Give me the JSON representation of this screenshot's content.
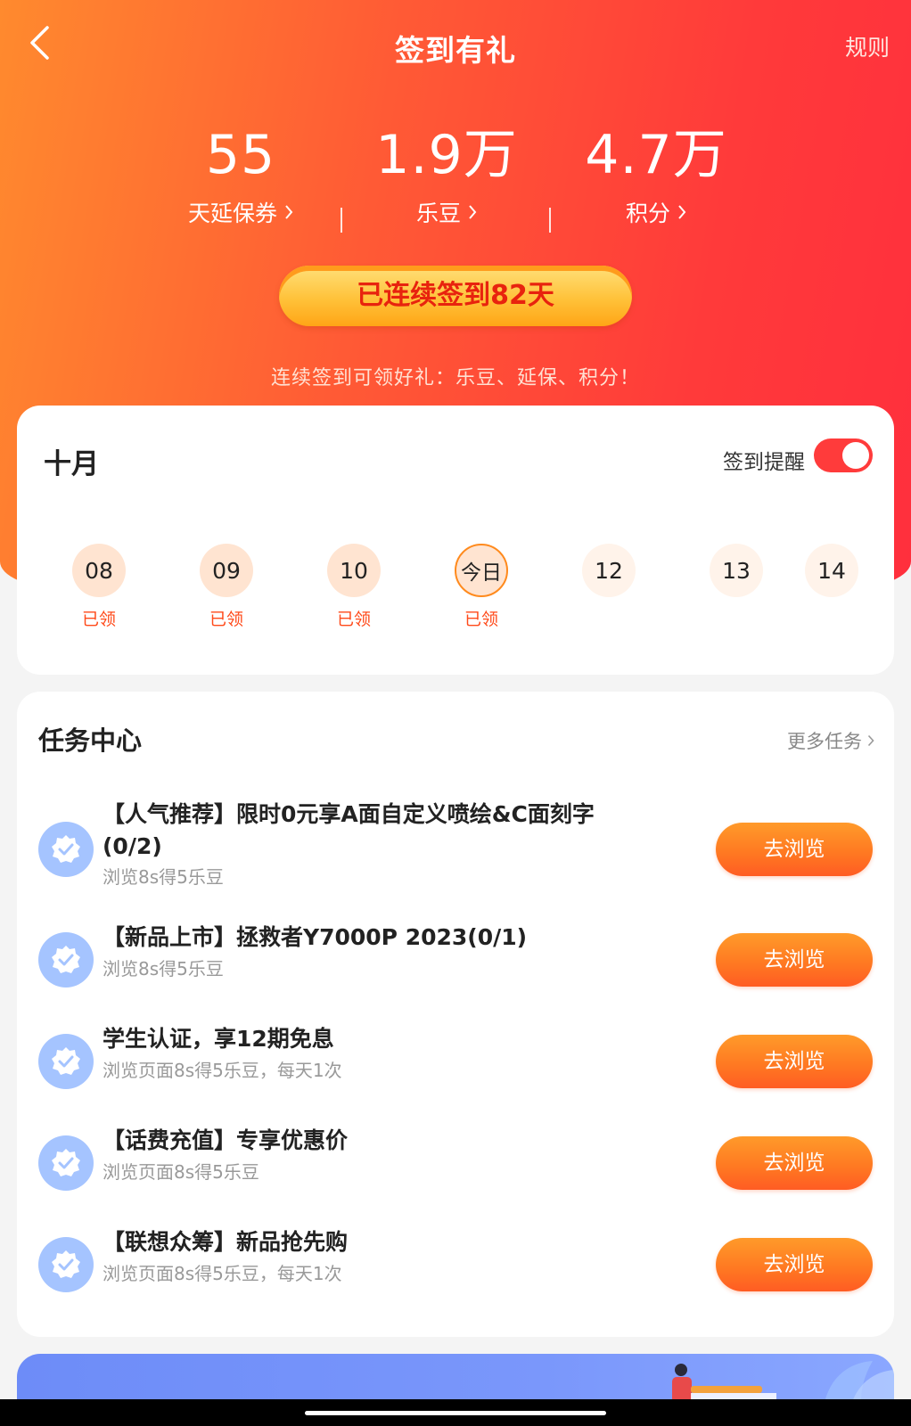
{
  "header": {
    "title": "签到有礼",
    "rules_label": "规则",
    "back_icon": "chevron-left-icon"
  },
  "stats": [
    {
      "value": "55",
      "label": "天延保券"
    },
    {
      "value": "1.9万",
      "label": "乐豆"
    },
    {
      "value": "4.7万",
      "label": "积分"
    }
  ],
  "streak": {
    "label": "已连续签到82天",
    "hint": "连续签到可领好礼：乐豆、延保、积分！"
  },
  "calendar": {
    "month": "十月",
    "reminder_label": "签到提醒",
    "reminder_on": true,
    "days": [
      {
        "day": "08",
        "status": "已领"
      },
      {
        "day": "09",
        "status": "已领"
      },
      {
        "day": "10",
        "status": "已领"
      },
      {
        "day": "今日",
        "status": "已领"
      },
      {
        "day": "12",
        "status": ""
      },
      {
        "day": "13",
        "status": ""
      },
      {
        "day": "14",
        "status": ""
      }
    ]
  },
  "tasks": {
    "title": "任务中心",
    "more_label": "更多任务",
    "items": [
      {
        "name": "【人气推荐】限时0元享A面自定义喷绘&C面刻字(0/2)",
        "desc": "浏览8s得5乐豆",
        "button": "去浏览"
      },
      {
        "name": "【新品上市】拯救者Y7000P 2023(0/1)",
        "desc": "浏览8s得5乐豆",
        "button": "去浏览"
      },
      {
        "name": "学生认证，享12期免息",
        "desc": "浏览页面8s得5乐豆，每天1次",
        "button": "去浏览"
      },
      {
        "name": "【话费充值】专享优惠价",
        "desc": "浏览页面8s得5乐豆",
        "button": "去浏览"
      },
      {
        "name": "【联想众筹】新品抢先购",
        "desc": "浏览页面8s得5乐豆，每天1次",
        "button": "去浏览"
      }
    ]
  },
  "colors": {
    "hero_start": "#ff8a2e",
    "hero_end": "#ff2f3d",
    "accent_orange": "#ff7a22",
    "toggle_on": "#ff3b3b",
    "badge_blue": "#a5c4ff"
  }
}
